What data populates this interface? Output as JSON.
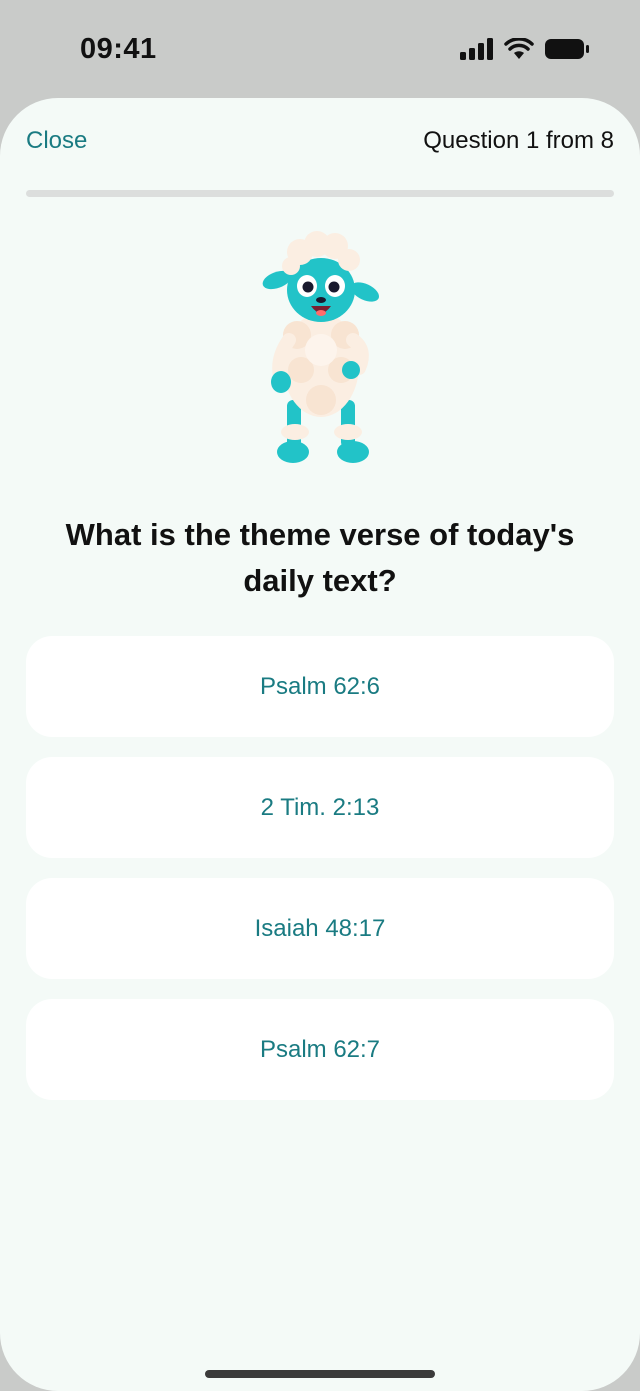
{
  "status_bar": {
    "time": "09:41"
  },
  "header": {
    "close_label": "Close",
    "question_counter": "Question 1 from 8"
  },
  "progress": {
    "current": 1,
    "total": 8
  },
  "mascot": {
    "icon": "lamb-mascot-icon"
  },
  "question": {
    "text": "What is the theme verse of today's daily text?"
  },
  "answers": [
    {
      "label": "Psalm 62:6"
    },
    {
      "label": "2 Tim. 2:13"
    },
    {
      "label": "Isaiah 48:17"
    },
    {
      "label": "Psalm 62:7"
    }
  ],
  "colors": {
    "accent": "#1a7b82",
    "background": "#f4faf7",
    "card": "#ffffff",
    "mascot_body": "#22c3c8"
  }
}
